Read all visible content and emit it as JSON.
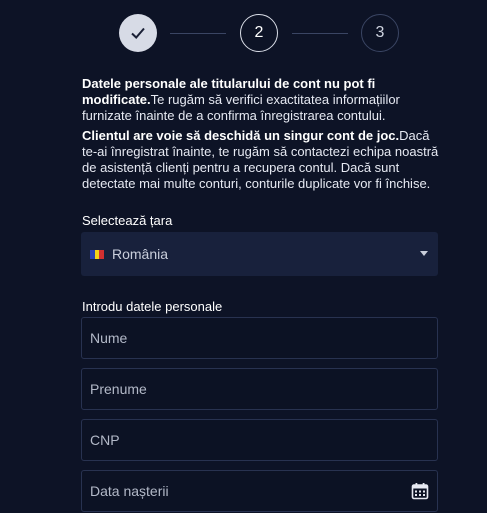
{
  "stepper": {
    "steps": [
      {
        "state": "completed",
        "icon": "check-icon"
      },
      {
        "label": "2",
        "state": "current"
      },
      {
        "label": "3",
        "state": "upcoming"
      }
    ]
  },
  "info": {
    "paragraph1_bold": "Datele personale ale titularului de cont nu pot fi modificate.",
    "paragraph1_text": "Te rugăm să verifici exactitatea informațiilor furnizate înainte de a confirma înregistrarea contului.",
    "paragraph2_bold": "Clientul are voie să deschidă un singur cont de joc.",
    "paragraph2_text": "Dacă te-ai înregistrat înainte, te rugăm să contactezi echipa noastră de asistență clienți pentru a recupera contul. Dacă sunt detectate mai multe conturi, conturile duplicate vor fi închise."
  },
  "country": {
    "label": "Selectează țara",
    "selected": "România",
    "flag_colors": [
      "#2b3fb3",
      "#f5d11a",
      "#d23030"
    ]
  },
  "personal": {
    "label": "Introdu datele personale",
    "fields": {
      "nume": {
        "placeholder": "Nume"
      },
      "prenume": {
        "placeholder": "Prenume"
      },
      "cnp": {
        "placeholder": "CNP"
      },
      "data_nasterii": {
        "placeholder": "Data nașterii",
        "icon": "calendar-icon"
      }
    }
  },
  "colors": {
    "background": "#0d1326",
    "select_bg": "#18213c",
    "field_border": "#283250"
  }
}
